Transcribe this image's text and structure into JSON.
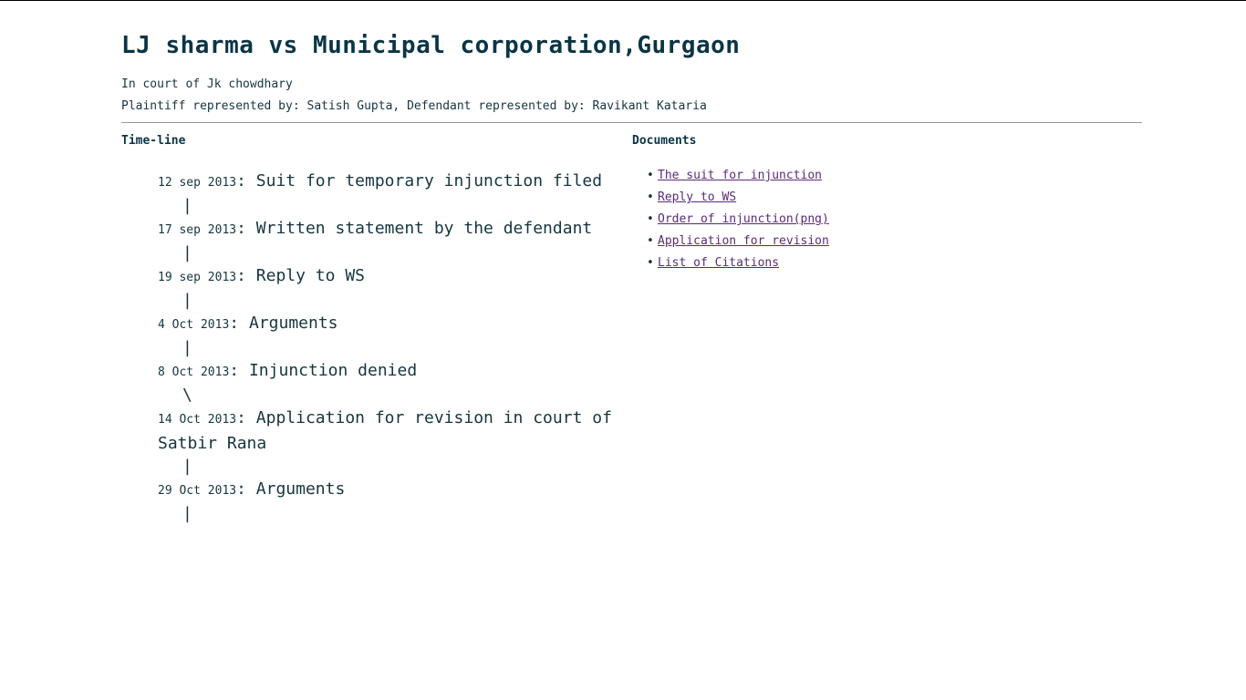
{
  "case": {
    "title": "LJ sharma vs Municipal corporation,Gurgaon",
    "court": "In court of Jk chowdhary",
    "representation": "Plaintiff represented by: Satish Gupta, Defendant represented by: Ravikant Kataria"
  },
  "timeline": {
    "heading": "Time-line",
    "events": [
      {
        "date": "12 sep 2013",
        "text": "Suit for temporary injunction filed",
        "connector": "|"
      },
      {
        "date": "17 sep 2013",
        "text": "Written statement by the defendant",
        "connector": "|"
      },
      {
        "date": "19 sep 2013",
        "text": "Reply to WS",
        "connector": "|"
      },
      {
        "date": "4 Oct 2013",
        "text": "Arguments",
        "connector": "|"
      },
      {
        "date": "8 Oct 2013",
        "text": "Injunction denied",
        "connector": "\\"
      },
      {
        "date": "14 Oct 2013",
        "text": "Application for revision in court of Satbir Rana",
        "connector": "|"
      },
      {
        "date": "29 Oct 2013",
        "text": "Arguments",
        "connector": "|"
      }
    ]
  },
  "documents": {
    "heading": "Documents",
    "items": [
      "The suit for injunction",
      "Reply to WS",
      "Order of injunction(png)",
      "Application for revision",
      "List of Citations"
    ]
  },
  "colors": {
    "text": "#0b3545",
    "link_visited": "#5a2a7a",
    "rule": "#9a9a9a"
  }
}
